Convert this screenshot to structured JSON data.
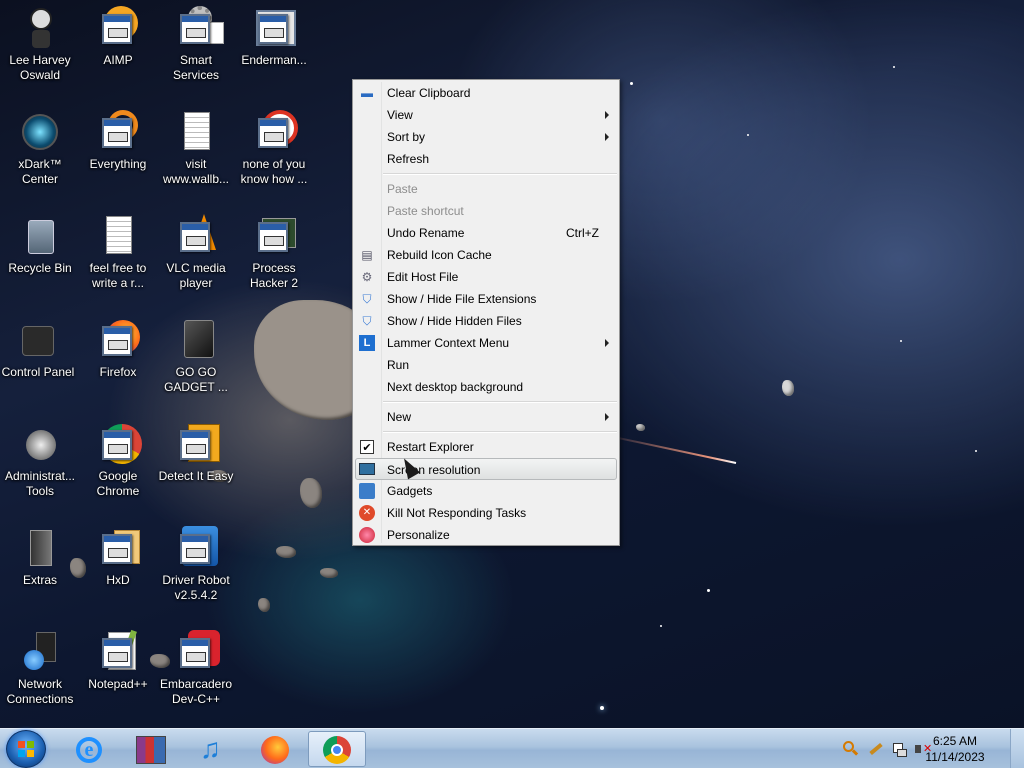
{
  "desktop": {
    "icons": [
      {
        "label": "Lee Harvey Oswald",
        "icon": "character-icon"
      },
      {
        "label": "AIMP",
        "icon": "aimp-icon"
      },
      {
        "label": "Smart Services",
        "icon": "gear-icon"
      },
      {
        "label": "Enderman...",
        "icon": "window-app-icon"
      },
      {
        "label": "xDark™ Center",
        "icon": "xdark-icon"
      },
      {
        "label": "Everything",
        "icon": "everything-icon"
      },
      {
        "label": "visit www.wallb...",
        "icon": "document-icon"
      },
      {
        "label": "none of you know how ...",
        "icon": "app-icon"
      },
      {
        "label": "Recycle Bin",
        "icon": "recycle-bin-icon"
      },
      {
        "label": "feel free to write a r...",
        "icon": "text-document-icon"
      },
      {
        "label": "VLC media player",
        "icon": "vlc-icon"
      },
      {
        "label": "Process Hacker 2",
        "icon": "process-hacker-icon"
      },
      {
        "label": "Control Panel",
        "icon": "control-panel-icon"
      },
      {
        "label": "Firefox",
        "icon": "firefox-icon"
      },
      {
        "label": "GO GO GADGET ...",
        "icon": "gadget-icon"
      },
      {
        "label": "Administrat... Tools",
        "icon": "admin-tools-icon"
      },
      {
        "label": "Google Chrome",
        "icon": "chrome-icon"
      },
      {
        "label": "Detect It Easy",
        "icon": "detect-it-easy-icon"
      },
      {
        "label": "Extras",
        "icon": "folder-icon"
      },
      {
        "label": "HxD",
        "icon": "hxd-icon"
      },
      {
        "label": "Driver Robot v2.5.4.2",
        "icon": "driver-robot-icon"
      },
      {
        "label": "Network Connections",
        "icon": "network-icon"
      },
      {
        "label": "Notepad++",
        "icon": "notepadpp-icon"
      },
      {
        "label": "Embarcadero Dev-C++",
        "icon": "devcpp-icon"
      }
    ]
  },
  "context_menu": {
    "items": [
      {
        "label": "Clear Clipboard",
        "icon": "clipboard-icon",
        "state": "normal"
      },
      {
        "label": "View",
        "submenu": true
      },
      {
        "label": "Sort by",
        "submenu": true
      },
      {
        "label": "Refresh"
      },
      {
        "label": "Paste",
        "state": "disabled"
      },
      {
        "label": "Paste shortcut",
        "state": "disabled"
      },
      {
        "label": "Undo Rename",
        "shortcut": "Ctrl+Z"
      },
      {
        "label": "Rebuild Icon Cache",
        "icon": "rebuild-icon"
      },
      {
        "label": "Edit Host File",
        "icon": "gear-icon"
      },
      {
        "label": "Show / Hide File Extensions",
        "icon": "shield-icon"
      },
      {
        "label": "Show / Hide Hidden Files",
        "icon": "shield-icon"
      },
      {
        "label": "Lammer Context Menu",
        "icon": "lammer-icon",
        "submenu": true
      },
      {
        "label": "Run"
      },
      {
        "label": "Next desktop background"
      },
      {
        "label": "New",
        "submenu": true
      },
      {
        "label": "Restart Explorer",
        "icon": "checkbox-icon"
      },
      {
        "label": "Screen resolution",
        "icon": "monitor-icon",
        "state": "highlighted"
      },
      {
        "label": "Gadgets",
        "icon": "gadgets-icon"
      },
      {
        "label": "Kill Not Responding Tasks",
        "icon": "kill-icon"
      },
      {
        "label": "Personalize",
        "icon": "personalize-icon"
      }
    ]
  },
  "taskbar": {
    "pinned": [
      {
        "name": "Internet Explorer",
        "icon": "ie-icon"
      },
      {
        "name": "WinRAR",
        "icon": "archive-icon"
      },
      {
        "name": "Music",
        "icon": "music-icon"
      },
      {
        "name": "Firefox",
        "icon": "firefox-icon"
      },
      {
        "name": "Google Chrome",
        "icon": "chrome-icon",
        "active": true
      }
    ],
    "clock": {
      "time": "6:25 AM",
      "date": "11/14/2023"
    }
  },
  "colors": {
    "accent": "#2a5ea8",
    "menu_bg": "#f0f0f0",
    "taskbar": "#a9c3de"
  }
}
